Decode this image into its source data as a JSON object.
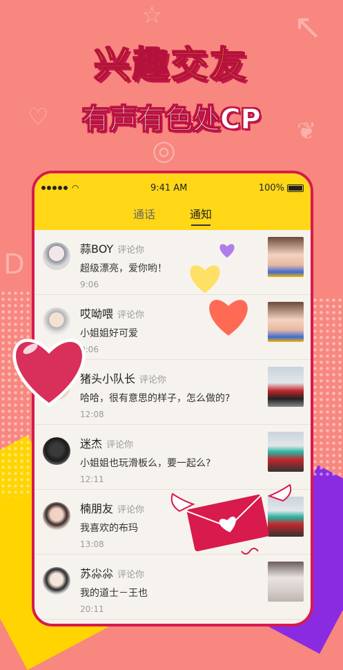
{
  "hero": {
    "title": "兴趣交友",
    "subtitle": "有声有色处CP"
  },
  "status_bar": {
    "time": "9:41 AM",
    "battery": "100%"
  },
  "tabs": [
    {
      "label": "通话",
      "active": false
    },
    {
      "label": "通知",
      "active": true
    }
  ],
  "notifications": [
    {
      "user": "蒜BOY",
      "action": "评论你",
      "message": "超级漂亮，爱你哟！",
      "time": "9:06"
    },
    {
      "user": "哎呦喂",
      "action": "评论你",
      "message": "小姐姐好可爱",
      "time": "9:06"
    },
    {
      "user": "猪头小队长",
      "action": "评论你",
      "message": "哈哈，很有意思的样子，怎么做的?",
      "time": "12:08"
    },
    {
      "user": "迷杰",
      "action": "评论你",
      "message": "小姐姐也玩滑板么，要一起么?",
      "time": "12:11"
    },
    {
      "user": "楠朋友",
      "action": "评论你",
      "message": "我喜欢的布玛",
      "time": "13:08"
    },
    {
      "user": "苏尛尛",
      "action": "评论你",
      "message": "我的道士－王也",
      "time": "20:11"
    }
  ],
  "colors": {
    "background": "#f7877f",
    "accent_yellow": "#ffd717",
    "brand_red": "#d81a4c"
  }
}
